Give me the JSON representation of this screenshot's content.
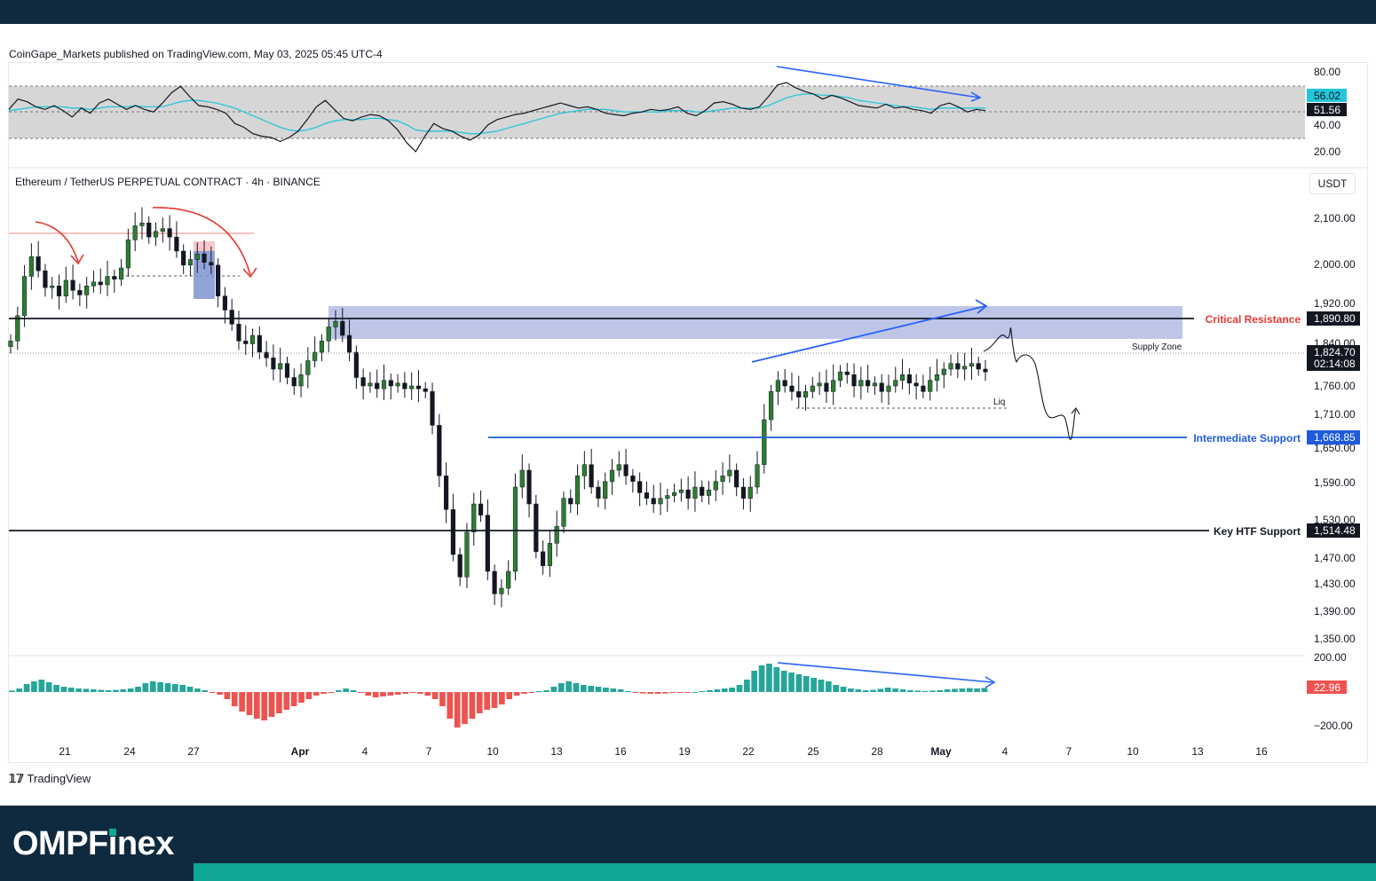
{
  "header": {
    "publisher_line": "CoinGape_Markets published on TradingView.com, May 03, 2025 05:45 UTC-4",
    "symbol_line": "Ethereum / TetherUS PERPETUAL CONTRACT · 4h · BINANCE",
    "currency": "USDT"
  },
  "branding": {
    "tradingview": "TradingView",
    "omp_prefix": "OMPF",
    "omp_suffix": "nex"
  },
  "colors": {
    "up": "#26a69a",
    "down": "#ef5350",
    "candle_up_body": "#2e7d32",
    "supply_zone": "#b7c0e4",
    "resistance_label": "#e53935",
    "support_label": "#1e5bdc",
    "trendline": "#2962ff",
    "rsi_ma": "#26c6da"
  },
  "chart_data": [
    {
      "type": "line",
      "name": "RSI panel",
      "y_ticks": [
        "80.00",
        "40.00",
        "20.00"
      ],
      "ylim": [
        15,
        85
      ],
      "band": [
        30,
        70
      ],
      "mid": 50,
      "series": [
        {
          "name": "RSI",
          "values": [
            55,
            63,
            61,
            57,
            55,
            58,
            54,
            49,
            56,
            52,
            60,
            63,
            59,
            55,
            58,
            55,
            53,
            60,
            68,
            73,
            65,
            58,
            57,
            55,
            52,
            44,
            41,
            36,
            34,
            33,
            30,
            33,
            38,
            47,
            57,
            62,
            55,
            48,
            46,
            49,
            51,
            50,
            46,
            39,
            29,
            22,
            34,
            44,
            40,
            38,
            34,
            31,
            35,
            43,
            47,
            49,
            51,
            52,
            54,
            56,
            58,
            60,
            58,
            56,
            57,
            55,
            52,
            51,
            50,
            52,
            53,
            55,
            54,
            55,
            57,
            52,
            50,
            54,
            60,
            61,
            59,
            56,
            55,
            57,
            65,
            74,
            76,
            72,
            69,
            67,
            63,
            66,
            64,
            61,
            58,
            57,
            56,
            59,
            56,
            57,
            55,
            54,
            52,
            58,
            60,
            57,
            53,
            55,
            54
          ]
        },
        {
          "name": "MA",
          "values": [
            54,
            55,
            56,
            57,
            57,
            57,
            57,
            56,
            56,
            55,
            56,
            57,
            57,
            57,
            58,
            57,
            57,
            57,
            59,
            61,
            62,
            62,
            61,
            60,
            58,
            56,
            53,
            50,
            47,
            44,
            41,
            39,
            38,
            39,
            41,
            44,
            46,
            47,
            47,
            47,
            48,
            48,
            47,
            46,
            43,
            39,
            38,
            38,
            38,
            38,
            37,
            36,
            36,
            37,
            38,
            40,
            42,
            44,
            46,
            48,
            50,
            52,
            53,
            54,
            55,
            55,
            55,
            54,
            53,
            53,
            53,
            53,
            53,
            54,
            54,
            54,
            53,
            53,
            54,
            55,
            56,
            56,
            56,
            56,
            58,
            61,
            64,
            66,
            67,
            67,
            66,
            66,
            65,
            64,
            62,
            61,
            60,
            59,
            58,
            57,
            57,
            56,
            55,
            56,
            56,
            56,
            56,
            56,
            56
          ]
        }
      ],
      "last_values": [
        "56.02",
        "51.56"
      ]
    },
    {
      "type": "candlestick",
      "name": "ETHUSDT 4h",
      "y_ticks": [
        "2,100.00",
        "2,000.00",
        "1,920.00",
        "1,840.00",
        "1,760.00",
        "1,710.00",
        "1,650.00",
        "1,590.00",
        "1,530.00",
        "1,470.00",
        "1,430.00",
        "1,390.00",
        "1,350.00"
      ],
      "x_ticks": [
        "21",
        "24",
        "27",
        "Apr",
        "4",
        "7",
        "10",
        "13",
        "16",
        "19",
        "22",
        "25",
        "28",
        "May",
        "4",
        "7",
        "10",
        "13",
        "16"
      ],
      "close": [
        1880,
        1925,
        1995,
        2030,
        2005,
        1975,
        1978,
        1960,
        1988,
        1970,
        1962,
        1978,
        1985,
        1980,
        1995,
        1990,
        2010,
        2060,
        2085,
        2090,
        2065,
        2075,
        2080,
        2065,
        2040,
        2015,
        2025,
        2035,
        2020,
        2015,
        1960,
        1935,
        1910,
        1880,
        1875,
        1890,
        1860,
        1850,
        1830,
        1840,
        1815,
        1800,
        1820,
        1845,
        1860,
        1880,
        1905,
        1915,
        1890,
        1860,
        1815,
        1800,
        1805,
        1795,
        1810,
        1800,
        1805,
        1795,
        1800,
        1795,
        1790,
        1730,
        1640,
        1580,
        1500,
        1460,
        1540,
        1590,
        1570,
        1470,
        1430,
        1440,
        1470,
        1620,
        1650,
        1590,
        1505,
        1480,
        1520,
        1550,
        1600,
        1590,
        1640,
        1660,
        1620,
        1600,
        1630,
        1650,
        1660,
        1640,
        1630,
        1610,
        1600,
        1590,
        1600,
        1605,
        1610,
        1615,
        1600,
        1620,
        1605,
        1615,
        1630,
        1640,
        1650,
        1620,
        1600,
        1620,
        1660,
        1740,
        1790,
        1810,
        1800,
        1790,
        1780,
        1790,
        1800,
        1805,
        1790,
        1810,
        1825,
        1820,
        1800,
        1810,
        1800,
        1805,
        1790,
        1800,
        1810,
        1820,
        1805,
        1800,
        1790,
        1810,
        1820,
        1830,
        1840,
        1830,
        1835,
        1840,
        1830,
        1825
      ]
    },
    {
      "type": "bar",
      "name": "Momentum histogram",
      "y_ticks": [
        "200.00",
        "−200.00"
      ],
      "ylim": [
        -200,
        200
      ],
      "last_value": "22.96",
      "values": [
        8,
        20,
        45,
        60,
        70,
        55,
        40,
        30,
        25,
        20,
        18,
        15,
        12,
        10,
        12,
        15,
        20,
        30,
        50,
        60,
        55,
        50,
        45,
        40,
        30,
        20,
        10,
        -5,
        -15,
        -40,
        -80,
        -110,
        -130,
        -150,
        -160,
        -140,
        -120,
        -100,
        -80,
        -60,
        -40,
        -20,
        -10,
        -5,
        10,
        20,
        10,
        -5,
        -20,
        -30,
        -25,
        -20,
        -15,
        -10,
        -5,
        -10,
        -20,
        -40,
        -80,
        -150,
        -200,
        -180,
        -150,
        -120,
        -100,
        -90,
        -70,
        -40,
        -20,
        -10,
        -5,
        5,
        10,
        30,
        50,
        60,
        50,
        40,
        35,
        30,
        25,
        20,
        15,
        5,
        -5,
        -8,
        -10,
        -10,
        -8,
        -5,
        -5,
        -3,
        0,
        5,
        10,
        15,
        20,
        25,
        40,
        70,
        120,
        150,
        160,
        140,
        120,
        110,
        100,
        90,
        80,
        70,
        60,
        40,
        30,
        20,
        15,
        10,
        12,
        18,
        25,
        20,
        15,
        10,
        8,
        5,
        8,
        10,
        15,
        18,
        20,
        22,
        20,
        23
      ]
    }
  ],
  "annotations": {
    "critical_resistance": {
      "label": "Critical Resistance",
      "value": "1,890.80"
    },
    "current_price": {
      "value": "1,824.70",
      "countdown": "02:14:08"
    },
    "supply_zone": "Supply Zone",
    "intermediate_support": {
      "label": "Intermediate Support",
      "value": "1,668.85"
    },
    "key_htf_support": {
      "label": "Key HTF Support",
      "value": "1,514.48"
    },
    "liq": "Liq"
  }
}
